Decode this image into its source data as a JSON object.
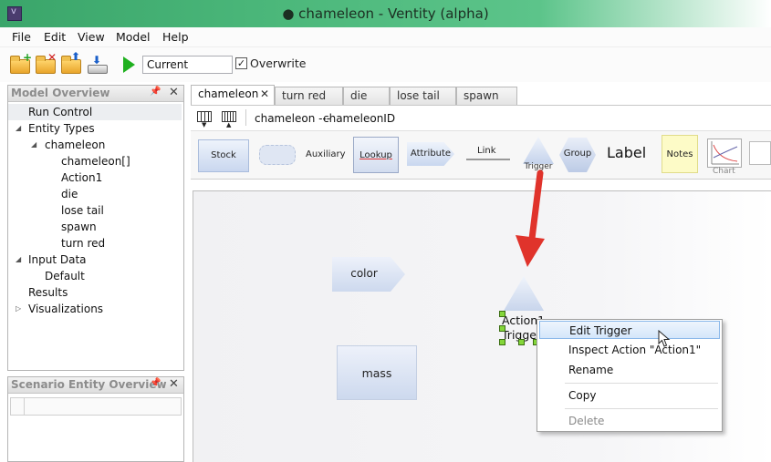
{
  "window": {
    "title": "● chameleon - Ventity (alpha)"
  },
  "menu": [
    "File",
    "Edit",
    "View",
    "Model",
    "Help"
  ],
  "toolbar": {
    "run_value": "Current",
    "overwrite_label": "Overwrite",
    "overwrite_checked": true
  },
  "model_overview": {
    "title": "Model Overview",
    "items": [
      {
        "label": "Run Control",
        "selected": true
      },
      {
        "label": "Entity Types",
        "expanded": true
      },
      {
        "label": "chameleon",
        "expanded": true
      },
      {
        "label": "chameleon[]"
      },
      {
        "label": "Action1"
      },
      {
        "label": "die"
      },
      {
        "label": "lose tail"
      },
      {
        "label": "spawn"
      },
      {
        "label": "turn red"
      },
      {
        "label": "Input Data",
        "expanded": true
      },
      {
        "label": "Default"
      },
      {
        "label": "Results"
      },
      {
        "label": "Visualizations",
        "expanded": false
      }
    ]
  },
  "scenario_overview": {
    "title": "Scenario Entity Overview"
  },
  "tabs": [
    {
      "label": "chameleon",
      "active": true
    },
    {
      "label": "turn red"
    },
    {
      "label": "die"
    },
    {
      "label": "lose tail"
    },
    {
      "label": "spawn"
    }
  ],
  "subbar": {
    "entity": "chameleon ---",
    "id": "chameleonID"
  },
  "palette": {
    "stock": "Stock",
    "auxiliary": "Auxiliary",
    "lookup": "Lookup",
    "attribute": "Attribute",
    "link": "Link",
    "trigger": "Trigger",
    "group": "Group",
    "label": "Label",
    "notes": "Notes",
    "chart": "Chart"
  },
  "canvas": {
    "color_node": "color",
    "mass_node": "mass",
    "trigger_line1": "Action1",
    "trigger_line2": "Trigger"
  },
  "context_menu": {
    "items": [
      {
        "label": "Edit Trigger",
        "hover": true
      },
      {
        "label": "Inspect Action \"Action1\""
      },
      {
        "label": "Rename"
      },
      {
        "label": "Copy"
      },
      {
        "label": "Delete",
        "disabled": true
      }
    ]
  },
  "colors": {
    "titlebar": "#4bb77a",
    "play": "#1fb01f",
    "arrow": "#e0332b",
    "handle": "#84d63a"
  }
}
